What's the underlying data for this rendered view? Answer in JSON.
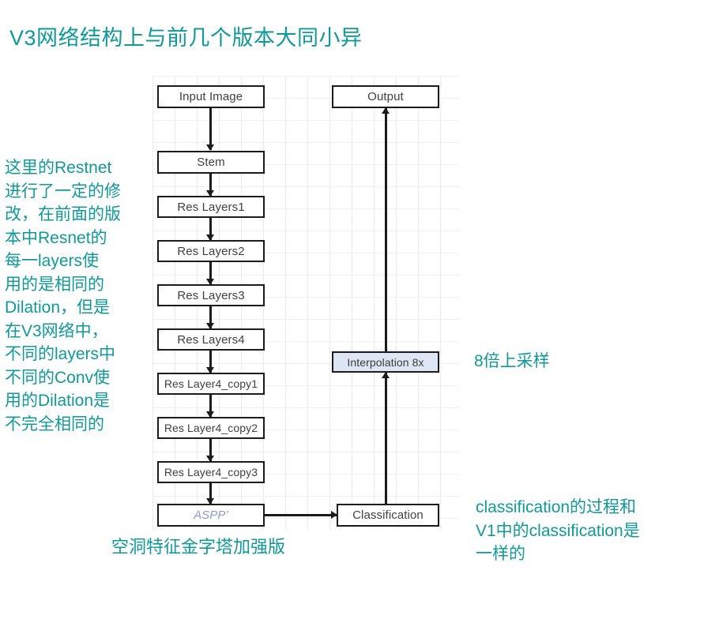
{
  "title": "V3网络结构上与前几个版本大同小异",
  "colors": {
    "annotation_teal": "#10999a",
    "box_border": "#1b1b1b",
    "box_text": "#404040",
    "aspp_text": "#8a9cd4",
    "interpolation_fill": "#dde6f2",
    "grid_line": "#ececec",
    "background": "#ffffff"
  },
  "diagram": {
    "backbone_nodes": [
      {
        "label": "Input Image"
      },
      {
        "label": "Stem"
      },
      {
        "label": "Res Layers1"
      },
      {
        "label": "Res Layers2"
      },
      {
        "label": "Res Layers3"
      },
      {
        "label": "Res Layers4"
      },
      {
        "label": "Res Layer4_copy1"
      },
      {
        "label": "Res Layer4_copy2"
      },
      {
        "label": "Res Layer4_copy3"
      },
      {
        "label": "ASPP’"
      }
    ],
    "head_nodes": [
      {
        "label": "Output"
      },
      {
        "label": "Interpolation 8x"
      },
      {
        "label": "Classification"
      }
    ]
  },
  "annotations": {
    "left": "这里的Restnet\n进行了一定的修\n改，在前面的版\n本中Resnet的\n每一layers使\n用的是相同的\nDilation，但是\n在V3网络中，\n不同的layers中\n不同的Conv使\n用的Dilation是\n不完全相同的",
    "aspp_caption": "空洞特征金字塔加强版",
    "upsample": "8倍上采样",
    "classification": "classification的过程和\nV1中的classification是\n一样的"
  }
}
